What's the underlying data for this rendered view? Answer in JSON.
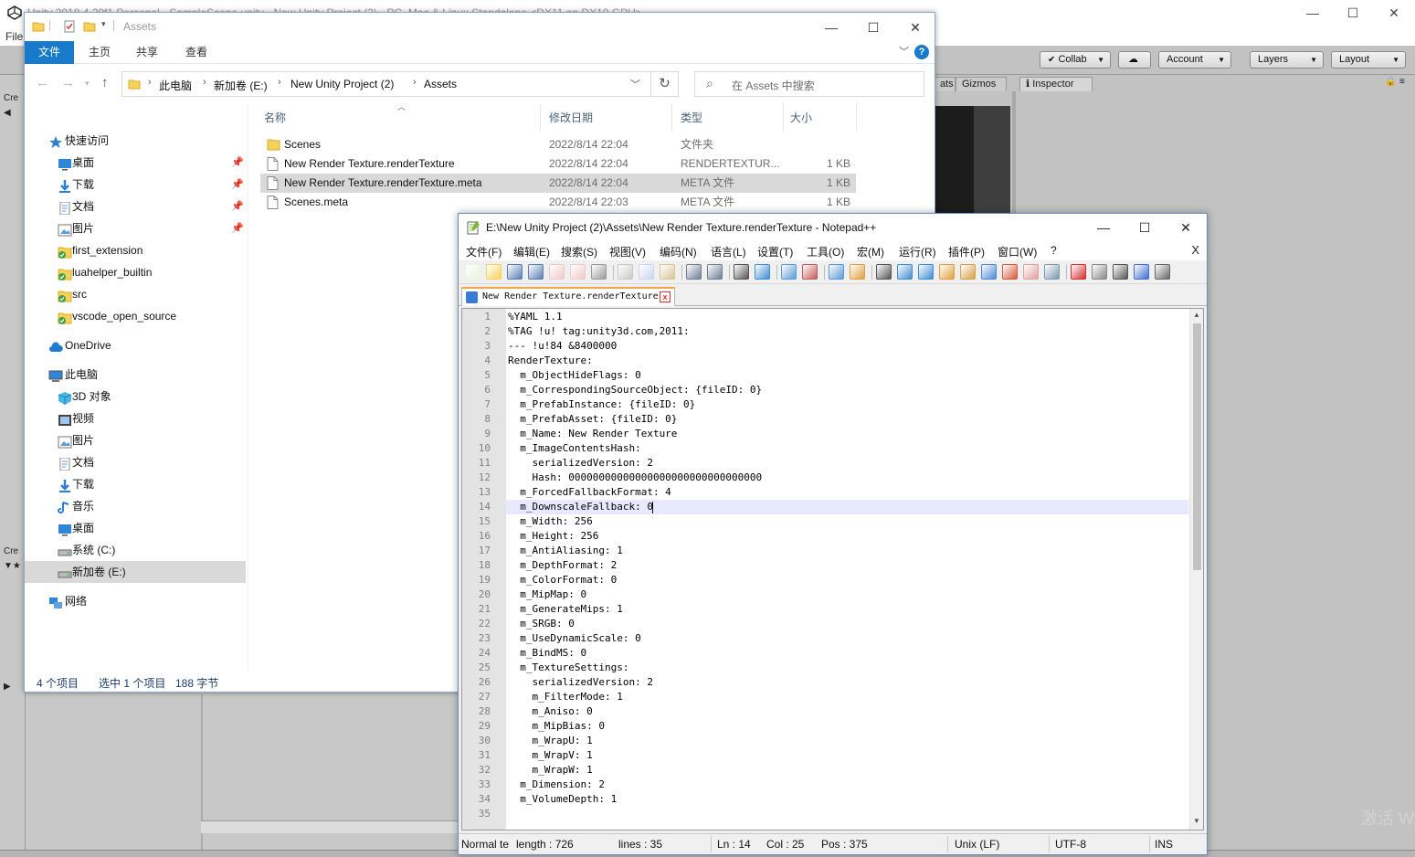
{
  "unity": {
    "title": "Unity 2018.4.20f1 Personal - SampleScene.unity - New Unity Project (2) - PC, Mac & Linux Standalone <DX11 on DX10 GPU>",
    "menu_file": "File",
    "toolbar": {
      "collab": "Collab",
      "account": "Account",
      "layers": "Layers",
      "layout": "Layout"
    },
    "tabs": {
      "stats": "ats",
      "gizmos": "Gizmos",
      "inspector": "Inspector"
    },
    "left_panel": {
      "create_1": "Cre",
      "create_2": "Cre"
    },
    "watermark": "激活 W"
  },
  "explorer": {
    "title": "Assets",
    "ribbon": {
      "file": "文件",
      "home": "主页",
      "share": "共享",
      "view": "查看",
      "help": "?"
    },
    "address": [
      "此电脑",
      "新加卷 (E:)",
      "New Unity Project (2)",
      "Assets"
    ],
    "search_placeholder": "在 Assets 中搜索",
    "sidebar": [
      {
        "label": "快速访问",
        "icon": "star-icon",
        "pinned": false
      },
      {
        "label": "桌面",
        "icon": "desktop-icon",
        "pinned": true
      },
      {
        "label": "下载",
        "icon": "download-icon",
        "pinned": true
      },
      {
        "label": "文档",
        "icon": "document-icon",
        "pinned": true
      },
      {
        "label": "图片",
        "icon": "picture-icon",
        "pinned": true
      },
      {
        "label": "first_extension",
        "icon": "folder-sync-icon",
        "pinned": false
      },
      {
        "label": "luahelper_builtin",
        "icon": "folder-sync-icon",
        "pinned": false
      },
      {
        "label": "src",
        "icon": "folder-sync-icon",
        "pinned": false
      },
      {
        "label": "vscode_open_source",
        "icon": "folder-sync-icon",
        "pinned": false
      },
      {
        "label": "OneDrive",
        "icon": "cloud-icon",
        "pinned": false
      },
      {
        "label": "此电脑",
        "icon": "computer-icon",
        "pinned": false
      },
      {
        "label": "3D 对象",
        "icon": "cube-icon",
        "pinned": false
      },
      {
        "label": "视频",
        "icon": "video-icon",
        "pinned": false
      },
      {
        "label": "图片",
        "icon": "picture-icon",
        "pinned": false
      },
      {
        "label": "文档",
        "icon": "document-icon",
        "pinned": false
      },
      {
        "label": "下载",
        "icon": "download-icon",
        "pinned": false
      },
      {
        "label": "音乐",
        "icon": "music-icon",
        "pinned": false
      },
      {
        "label": "桌面",
        "icon": "desktop-icon",
        "pinned": false
      },
      {
        "label": "系统 (C:)",
        "icon": "drive-icon",
        "pinned": false
      },
      {
        "label": "新加卷 (E:)",
        "icon": "drive-icon",
        "pinned": false
      },
      {
        "label": "网络",
        "icon": "network-icon",
        "pinned": false
      }
    ],
    "columns": {
      "name": "名称",
      "date": "修改日期",
      "type": "类型",
      "size": "大小"
    },
    "files": [
      {
        "name": "Scenes",
        "date": "2022/8/14 22:04",
        "type": "文件夹",
        "size": "",
        "kind": "folder"
      },
      {
        "name": "New Render Texture.renderTexture",
        "date": "2022/8/14 22:04",
        "type": "RENDERTEXTUR...",
        "size": "1 KB",
        "kind": "file"
      },
      {
        "name": "New Render Texture.renderTexture.meta",
        "date": "2022/8/14 22:04",
        "type": "META 文件",
        "size": "1 KB",
        "kind": "file"
      },
      {
        "name": "Scenes.meta",
        "date": "2022/8/14 22:03",
        "type": "META 文件",
        "size": "1 KB",
        "kind": "file"
      }
    ],
    "status": {
      "count": "4 个项目",
      "selection": "选中 1 个项目",
      "bytes": "188 字节"
    }
  },
  "notepad": {
    "title": "E:\\New Unity Project (2)\\Assets\\New Render Texture.renderTexture - Notepad++",
    "menus": [
      "文件(F)",
      "编辑(E)",
      "搜索(S)",
      "视图(V)",
      "编码(N)",
      "语言(L)",
      "设置(T)",
      "工具(O)",
      "宏(M)",
      "运行(R)",
      "插件(P)",
      "窗口(W)",
      "?"
    ],
    "menu_close": "X",
    "tab": "New Render Texture.renderTexture",
    "tab_close": "x",
    "lines": [
      "%YAML 1.1",
      "%TAG !u! tag:unity3d.com,2011:",
      "--- !u!84 &8400000",
      "RenderTexture:",
      "  m_ObjectHideFlags: 0",
      "  m_CorrespondingSourceObject: {fileID: 0}",
      "  m_PrefabInstance: {fileID: 0}",
      "  m_PrefabAsset: {fileID: 0}",
      "  m_Name: New Render Texture",
      "  m_ImageContentsHash:",
      "    serializedVersion: 2",
      "    Hash: 00000000000000000000000000000000",
      "  m_ForcedFallbackFormat: 4",
      "  m_DownscaleFallback: 0",
      "  m_Width: 256",
      "  m_Height: 256",
      "  m_AntiAliasing: 1",
      "  m_DepthFormat: 2",
      "  m_ColorFormat: 0",
      "  m_MipMap: 0",
      "  m_GenerateMips: 1",
      "  m_SRGB: 0",
      "  m_UseDynamicScale: 0",
      "  m_BindMS: 0",
      "  m_TextureSettings:",
      "    serializedVersion: 2",
      "    m_FilterMode: 1",
      "    m_Aniso: 0",
      "    m_MipBias: 0",
      "    m_WrapU: 1",
      "    m_WrapV: 1",
      "    m_WrapW: 1",
      "  m_Dimension: 2",
      "  m_VolumeDepth: 1",
      ""
    ],
    "current_line": 14,
    "status": {
      "type": "Normal te",
      "length": "length : 726",
      "lines": "lines : 35",
      "ln": "Ln : 14",
      "col": "Col : 25",
      "pos": "Pos : 375",
      "eol": "Unix (LF)",
      "encoding": "UTF-8",
      "mode": "INS"
    }
  }
}
